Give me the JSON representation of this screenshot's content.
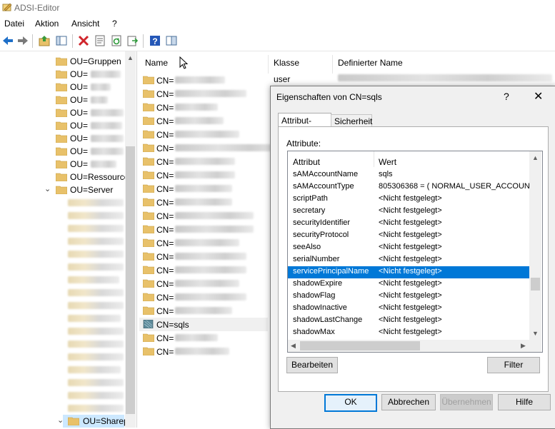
{
  "window": {
    "title": "ADSI-Editor"
  },
  "menu": [
    "Datei",
    "Aktion",
    "Ansicht",
    "?"
  ],
  "toolbar": {
    "icons": [
      "back-icon",
      "forward-icon",
      "up-folder-icon",
      "show-hide-tree-icon",
      "delete-icon",
      "properties-icon",
      "refresh-icon",
      "export-icon",
      "help-icon",
      "pane-icon"
    ]
  },
  "tree": {
    "visible_items": [
      {
        "label": "OU=Gruppen"
      },
      {
        "label": "OU="
      },
      {
        "label": "OU="
      },
      {
        "label": "OU="
      },
      {
        "label": "OU="
      },
      {
        "label": "OU="
      },
      {
        "label": "OU="
      },
      {
        "label": "OU="
      },
      {
        "label": "OU="
      },
      {
        "label": "OU=Ressource"
      },
      {
        "label": "OU=Server",
        "expanded": true
      },
      {
        "label": "OU=Sharep"
      }
    ]
  },
  "list": {
    "columns": [
      "Name",
      "Klasse",
      "Definierter Name"
    ],
    "first_row_class": "user",
    "rows": [
      "CN=",
      "CN=",
      "CN=",
      "CN=",
      "CN=",
      "CN=",
      "CN=",
      "CN=",
      "CN=",
      "CN=",
      "CN=",
      "CN=",
      "CN=",
      "CN=",
      "CN=",
      "CN=",
      "CN=",
      "CN=",
      "CN=sqls",
      "CN=",
      "CN="
    ]
  },
  "dialog": {
    "title": "Eigenschaften von CN=sqls",
    "help_glyph": "?",
    "close_glyph": "✕",
    "tabs": [
      "Attribut-Editor",
      "Sicherheit"
    ],
    "attributes_label": "Attribute:",
    "attr_columns": [
      "Attribut",
      "Wert"
    ],
    "attributes": [
      {
        "name": "sAMAccountName",
        "value": "sqls"
      },
      {
        "name": "sAMAccountType",
        "value": "805306368 = ( NORMAL_USER_ACCOUNT"
      },
      {
        "name": "scriptPath",
        "value": "<Nicht festgelegt>"
      },
      {
        "name": "secretary",
        "value": "<Nicht festgelegt>"
      },
      {
        "name": "securityIdentifier",
        "value": "<Nicht festgelegt>"
      },
      {
        "name": "securityProtocol",
        "value": "<Nicht festgelegt>"
      },
      {
        "name": "seeAlso",
        "value": "<Nicht festgelegt>"
      },
      {
        "name": "serialNumber",
        "value": "<Nicht festgelegt>"
      },
      {
        "name": "servicePrincipalName",
        "value": "<Nicht festgelegt>",
        "selected": true
      },
      {
        "name": "shadowExpire",
        "value": "<Nicht festgelegt>"
      },
      {
        "name": "shadowFlag",
        "value": "<Nicht festgelegt>"
      },
      {
        "name": "shadowInactive",
        "value": "<Nicht festgelegt>"
      },
      {
        "name": "shadowLastChange",
        "value": "<Nicht festgelegt>"
      },
      {
        "name": "shadowMax",
        "value": "<Nicht festgelegt>"
      }
    ],
    "edit_label": "Bearbeiten",
    "filter_label": "Filter",
    "ok_label": "OK",
    "cancel_label": "Abbrechen",
    "apply_label": "Übernehmen",
    "help_label": "Hilfe"
  },
  "colors": {
    "selection": "#0078d7",
    "folder": "#e8c16a"
  }
}
